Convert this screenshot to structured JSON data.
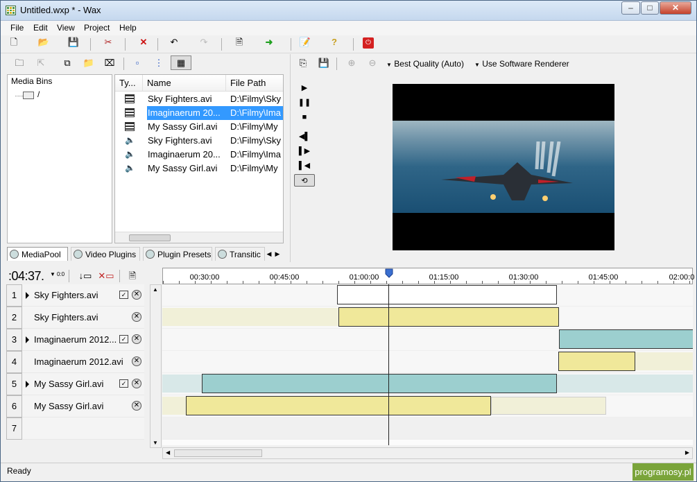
{
  "window": {
    "title": "Untitled.wxp * - Wax",
    "min": "–",
    "max": "□",
    "close": "✕"
  },
  "menu": [
    "File",
    "Edit",
    "View",
    "Project",
    "Help"
  ],
  "preview_toolbar": {
    "quality": "Best Quality (Auto)",
    "renderer": "Use Software Renderer"
  },
  "media_bins": {
    "title": "Media Bins",
    "root": "/"
  },
  "file_list": {
    "columns": [
      "Ty...",
      "Name",
      "File Path"
    ],
    "rows": [
      {
        "type": "video",
        "name": "Sky Fighters.avi",
        "path": "D:\\Filmy\\Sky"
      },
      {
        "type": "video",
        "name": "Imaginaerum 20...",
        "path": "D:\\Filmy\\Ima",
        "selected": true
      },
      {
        "type": "video",
        "name": "My Sassy Girl.avi",
        "path": "D:\\Filmy\\My"
      },
      {
        "type": "audio",
        "name": "Sky Fighters.avi",
        "path": "D:\\Filmy\\Sky"
      },
      {
        "type": "audio",
        "name": "Imaginaerum 20...",
        "path": "D:\\Filmy\\Ima"
      },
      {
        "type": "audio",
        "name": "My Sassy Girl.avi",
        "path": "D:\\Filmy\\My"
      }
    ]
  },
  "tabs": [
    "MediaPool",
    "Video Plugins",
    "Plugin Presets",
    "Transitic"
  ],
  "timeline": {
    "timecode": ":04:37.",
    "ruler_labels": [
      "00:30:00",
      "00:45:00",
      "01:00:00",
      "01:15:00",
      "01:30:00",
      "01:45:00",
      "02:00:0"
    ],
    "tracks": [
      {
        "num": "1",
        "name": "Sky Fighters.avi",
        "expand": true,
        "check": true
      },
      {
        "num": "2",
        "name": "Sky Fighters.avi",
        "expand": false,
        "check": false
      },
      {
        "num": "3",
        "name": "Imaginaerum 2012...",
        "expand": true,
        "check": true
      },
      {
        "num": "4",
        "name": "Imaginaerum 2012.avi",
        "expand": false,
        "check": false
      },
      {
        "num": "5",
        "name": "My Sassy Girl.avi",
        "expand": true,
        "check": true
      },
      {
        "num": "6",
        "name": "My Sassy Girl.avi",
        "expand": false,
        "check": false
      },
      {
        "num": "7",
        "name": "",
        "expand": false,
        "check": false
      }
    ],
    "colors": {
      "white": "#ffffff",
      "yellow": "#f0e89a",
      "teal": "#9ccfcf",
      "pale_yellow": "#f1f0d8",
      "pale_teal": "#d8e8e8"
    }
  },
  "status": {
    "text": "Ready",
    "watermark": "programosy.pl"
  }
}
